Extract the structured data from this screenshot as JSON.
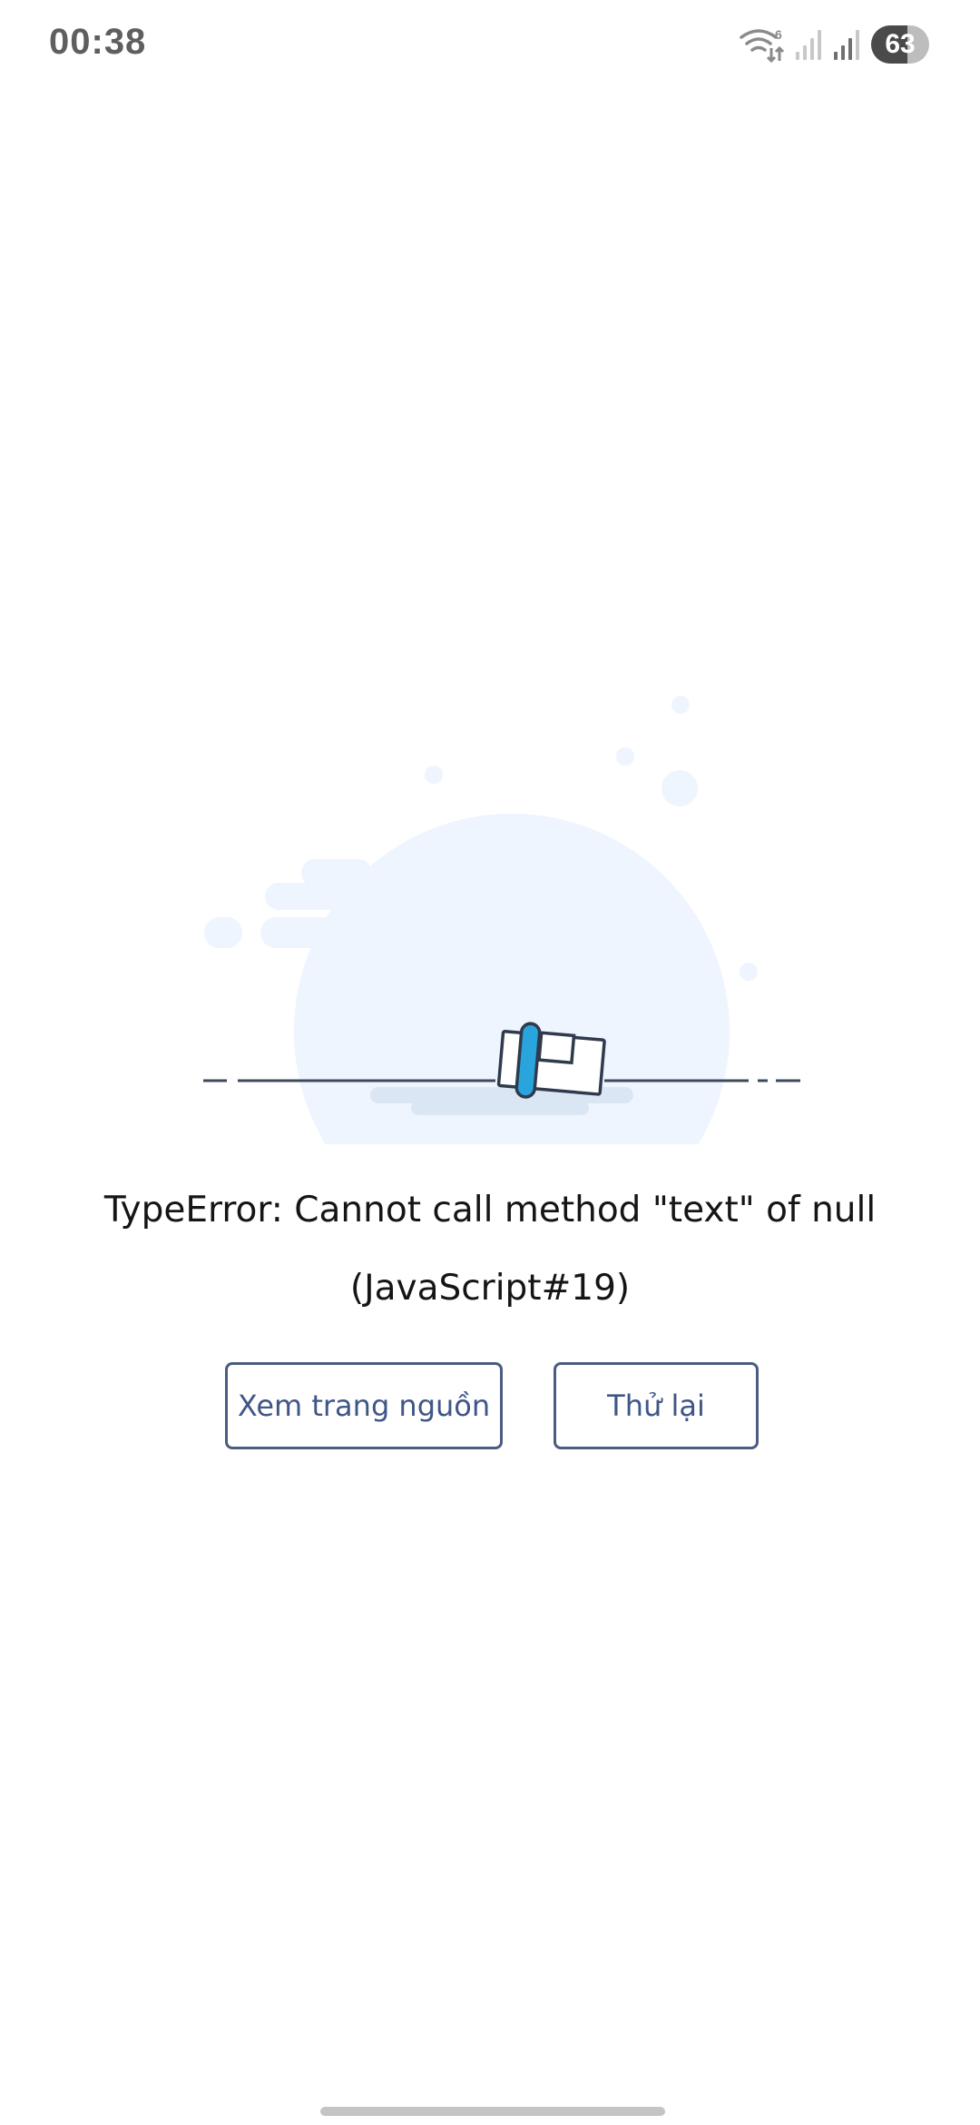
{
  "status_bar": {
    "time": "00:38",
    "battery_level": "63",
    "battery_fraction": 0.63,
    "wifi_badge": "6",
    "icons": [
      "wifi-icon",
      "signal-sim1-icon",
      "signal-sim2-icon",
      "battery-icon"
    ]
  },
  "error": {
    "line1": "TypeError: Cannot call method \"text\" of null",
    "line2": "(JavaScript#19)"
  },
  "actions": {
    "view_source_label": "Xem trang nguồn",
    "retry_label": "Thử lại"
  },
  "colors": {
    "button_border": "#4a5d80",
    "button_text": "#3f5686",
    "illustration_bg": "#eef5fe",
    "accent_blue": "#2aa4dd"
  }
}
